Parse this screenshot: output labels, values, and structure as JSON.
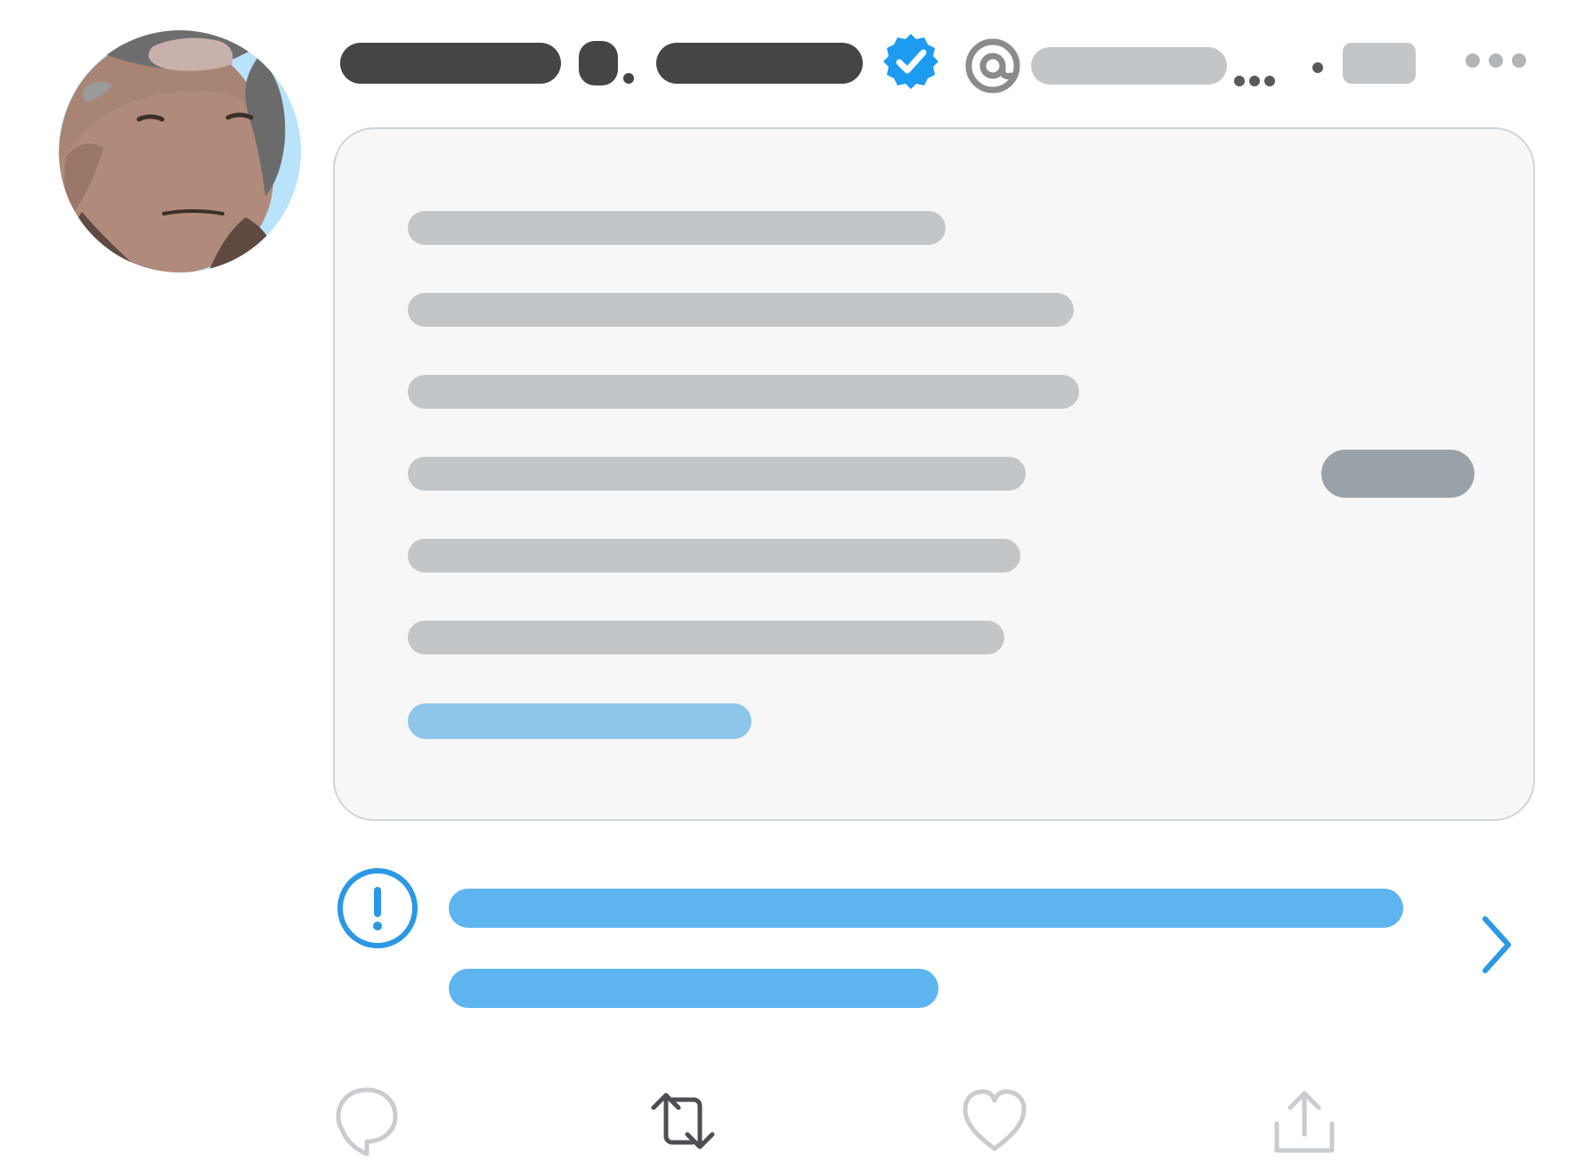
{
  "tweet": {
    "author": {
      "display_name": "",
      "handle": "",
      "timestamp": ""
    },
    "quoted": {
      "text": "",
      "link": ""
    },
    "notice": {
      "text": ""
    }
  },
  "icons": {
    "avatar": "avatar",
    "verified": "verified-badge-icon",
    "handle": "at-icon",
    "more": "more-icon",
    "notice": "exclamation-circle-icon",
    "chevron": "chevron-right-icon",
    "reply": "reply-icon",
    "retweet": "retweet-icon",
    "like": "heart-icon",
    "share": "share-icon"
  },
  "colors": {
    "accent": "#1d9bf0",
    "placeholder_dark": "#454545",
    "placeholder_light": "#c3c6c8",
    "card_bg": "#f7f7f7",
    "link_blue": "#8ec5ea"
  }
}
